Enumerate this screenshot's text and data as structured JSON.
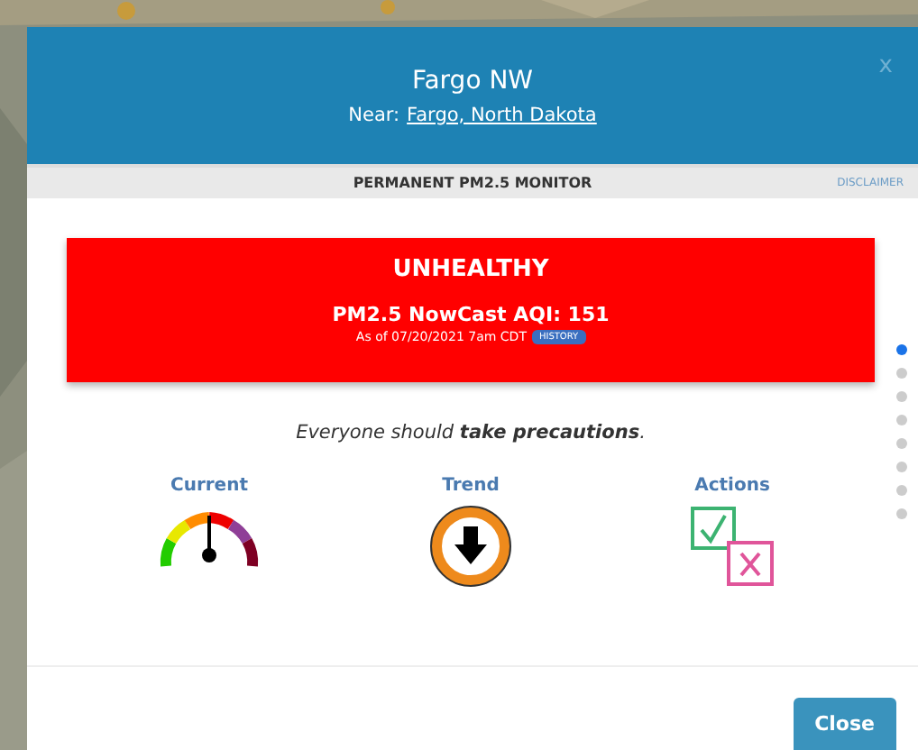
{
  "header": {
    "title": "Fargo NW",
    "near_label": "Near:",
    "near_link": "Fargo, North Dakota",
    "close": "x"
  },
  "subheader": {
    "title": "PERMANENT PM2.5 MONITOR",
    "disclaimer": "DISCLAIMER"
  },
  "status": {
    "category": "UNHEALTHY",
    "color": "#ff0000",
    "aqi": "PM2.5 NowCast AQI: 151",
    "as_of": "As of 07/20/2021 7am CDT",
    "history": "HISTORY"
  },
  "message": "Everyone should **take precautions**.",
  "panels": [
    {
      "label": "Current",
      "kind": "gauge"
    },
    {
      "label": "Trend",
      "kind": "trend"
    },
    {
      "label": "Actions",
      "kind": "actions"
    }
  ],
  "pager": [
    {
      "selected": true
    },
    {
      "selected": false
    },
    {
      "selected": false
    },
    {
      "selected": false
    },
    {
      "selected": false
    },
    {
      "selected": false
    },
    {
      "selected": false
    },
    {
      "selected": false
    }
  ],
  "footer": {
    "close": "Close"
  }
}
